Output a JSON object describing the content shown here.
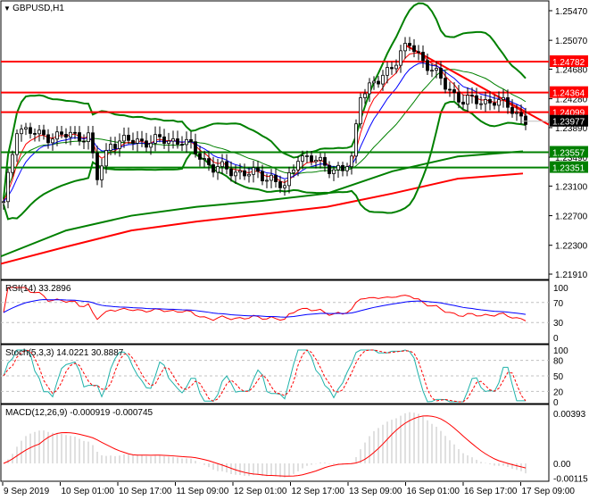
{
  "chart_data": {
    "type": "candlestick",
    "symbol_title": "GBPUSD,H1",
    "price_axis": [
      "1.25470",
      "1.25070",
      "1.24680",
      "1.24280",
      "1.23890",
      "1.23490",
      "1.23100",
      "1.22700",
      "1.22300",
      "1.21910"
    ],
    "ylim": [
      1.2191,
      1.2547
    ],
    "levels": [
      {
        "label": "1.24782",
        "value": 1.24782,
        "color": "#ff0000"
      },
      {
        "label": "1.24364",
        "value": 1.24364,
        "color": "#ff0000"
      },
      {
        "label": "1.24099",
        "value": 1.24099,
        "color": "#ff0000"
      },
      {
        "label": "1.23557",
        "value": 1.23557,
        "color": "#008000"
      },
      {
        "label": "1.23351",
        "value": 1.23351,
        "color": "#008000"
      }
    ],
    "current_price": {
      "label": "1.23977",
      "value": 1.23977
    },
    "trendline": {
      "from": 1.25,
      "to": 1.24,
      "color": "#ff0000"
    },
    "close_keypoints": [
      [
        0,
        1.2285
      ],
      [
        3,
        1.239
      ],
      [
        8,
        1.2378
      ],
      [
        19,
        1.2378
      ],
      [
        21,
        1.232
      ],
      [
        24,
        1.237
      ],
      [
        40,
        1.2372
      ],
      [
        47,
        1.2335
      ],
      [
        60,
        1.2322
      ],
      [
        63,
        1.2305
      ],
      [
        66,
        1.2352
      ],
      [
        76,
        1.233
      ],
      [
        78,
        1.2345
      ],
      [
        80,
        1.2438
      ],
      [
        84,
        1.245
      ],
      [
        89,
        1.249
      ],
      [
        91,
        1.25
      ],
      [
        95,
        1.2475
      ],
      [
        99,
        1.2445
      ],
      [
        103,
        1.2425
      ],
      [
        110,
        1.2425
      ],
      [
        114,
        1.2415
      ],
      [
        117,
        1.2398
      ]
    ],
    "ma_long_red": [
      1.2205,
      1.2228,
      1.225,
      1.2262,
      1.2272,
      1.2282,
      1.23,
      1.232,
      1.2327
    ],
    "ma_long_green": [
      1.2215,
      1.225,
      1.227,
      1.2282,
      1.229,
      1.23,
      1.233,
      1.235,
      1.2357
    ],
    "x_labels": [
      "9 Sep 2019",
      "10 Sep 01:00",
      "10 Sep 17:00",
      "11 Sep 09:00",
      "12 Sep 01:00",
      "12 Sep 17:00",
      "13 Sep 09:00",
      "16 Sep 01:00",
      "16 Sep 17:00",
      "17 Sep 09:00"
    ],
    "rsi": {
      "title": "RSI(14) 33.2896",
      "ticks": [
        "100",
        "70",
        "30",
        "0"
      ]
    },
    "stoch": {
      "title": "Stoch(5,3,3) 14.0221 30.8887",
      "ticks": [
        "100",
        "80",
        "50",
        "20",
        "0"
      ]
    },
    "macd": {
      "title": "MACD(12,26,9) -0.000919 -0.000745",
      "ticks": [
        "0.00393",
        "0.00",
        "-0.00115"
      ]
    }
  }
}
